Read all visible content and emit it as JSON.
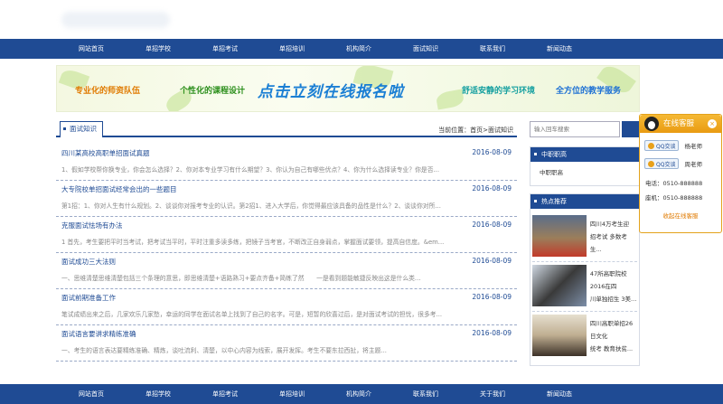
{
  "nav": {
    "top": [
      "网站首页",
      "单招学校",
      "单招考试",
      "单招培训",
      "机构简介",
      "面试知识",
      "联系我们",
      "新闻动态"
    ],
    "bottom": [
      "网站首页",
      "单招学校",
      "单招考试",
      "单招培训",
      "机构简介",
      "联系我们",
      "关于我们",
      "新闻动态"
    ]
  },
  "banner": {
    "slogan1": "专业化的师资队伍",
    "slogan2": "个性化的课程设计",
    "cta": "点击立刻在线报名啦",
    "slogan3": "舒适安静的学习环境",
    "slogan4": "全方位的教学服务"
  },
  "section": {
    "tab": "面试知识",
    "crumb_prefix": "当前位置：",
    "crumb_home": "首页",
    "crumb_sep": ">",
    "crumb_current": "面试知识"
  },
  "articles": [
    {
      "title": "四川某高校高职单招面试真题",
      "date": "2016-08-09",
      "summary": "1、假如学校帮你换专业，你会怎么选择？2、你对本专业学习有什么期望？3、你认为自己有哪些优点？4、你为什么选择读专业？你是否..."
    },
    {
      "title": "大专院校单招面试经常会出的一些题目",
      "date": "2016-08-09",
      "summary": "第1招：1、你对人生有什么规划。2、谈谈你对报考专业的认识。第2招1、进入大学后，你觉得最应该具备的品性是什么？2、谈谈你对所..."
    },
    {
      "title": "克服面试怯场有办法",
      "date": "2016-08-09",
      "summary": "1 首先，考生要把平时当考试，把考试当平时，平时注重多读多练，把镜子当考官，不断改正自身弱点，掌握面试要领，提高自信度。&em..."
    },
    {
      "title": "面试成功三大法则",
      "date": "2016-08-09",
      "summary": "一、思维清楚思维清楚包括三个条理的意思，即思维清楚+语路熟习+要点齐备+简练了然　　一是看到题能敏捷反映出这是什么类..."
    },
    {
      "title": "面试前期准备工作",
      "date": "2016-08-09",
      "summary": "笔试成绩出来之后，几家欢乐几家愁，幸运的同学在面试名单上找到了自己的名字。可是，短暂的欣喜过后，是对面试考试的担忧，很多考..."
    },
    {
      "title": "面试语言要讲求精练准确",
      "date": "2016-08-09",
      "summary": "一、考生的语言表达要精练准确、精炼，谈吐流利、清楚，以中心内容为线索，展开发挥。考生不要东拉西扯，将主题..."
    }
  ],
  "sidebar": {
    "search_placeholder": "输入回车搜索",
    "box1_title": "中职职高",
    "box1_item": "中职职高",
    "hot_title": "热点推荐",
    "hot": [
      {
        "line1": "四川4万考生迎",
        "line2": "招考试 多数考生..."
      },
      {
        "line1": "47所高职院校2016在四",
        "line2": "川单独招生 3美..."
      },
      {
        "line1": "四川高职单招26日文化",
        "line2": "统考 教育扶贫..."
      }
    ]
  },
  "service": {
    "title": "在线客服",
    "close": "×",
    "qq_label": "QQ交谈",
    "contacts": [
      "杨老师",
      "周老师"
    ],
    "phone": "电话：0510-888888",
    "fax": "座机：0510-888888",
    "footer": "收起在线客服"
  }
}
